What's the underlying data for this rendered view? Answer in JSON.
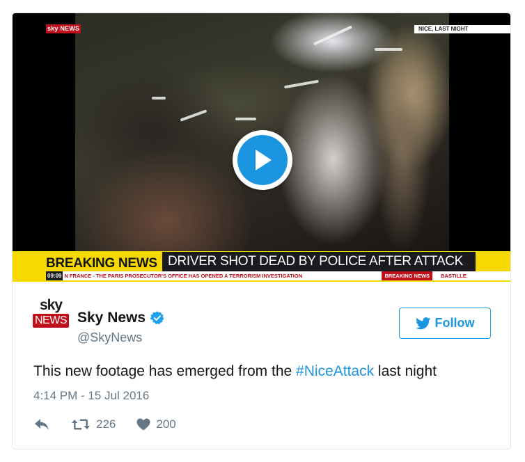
{
  "video": {
    "channel_logo": "sky NEWS",
    "location_bug": "NICE, LAST NIGHT",
    "breaking_label": "BREAKING NEWS",
    "headline": "DRIVER SHOT DEAD BY POLICE AFTER ATTACK",
    "ticker_time": "09:09",
    "ticker_text": "N FRANCE - THE PARIS PROSECUTOR'S OFFICE HAS OPENED A TERRORISM INVESTIGATION",
    "ticker_tag": "BREAKING NEWS",
    "ticker_next": "BASTILLE",
    "play_icon": "play-icon"
  },
  "author": {
    "avatar_top": "sky",
    "avatar_bottom": "NEWS",
    "display_name": "Sky News",
    "handle": "@SkyNews",
    "verified_icon": "verified-badge-icon"
  },
  "follow_button": {
    "label": "Follow",
    "icon": "twitter-bird-icon"
  },
  "tweet": {
    "text_before": "This new footage has emerged from the ",
    "hashtag": "#NiceAttack",
    "text_after": " last night",
    "timestamp": "4:14 PM - 15 Jul 2016"
  },
  "actions": {
    "reply_icon": "reply-icon",
    "retweet_icon": "retweet-icon",
    "retweet_count": "226",
    "like_icon": "heart-icon",
    "like_count": "200"
  },
  "colors": {
    "accent": "#1b95e0",
    "muted": "#657786",
    "sky_red": "#c20f1c",
    "breaking_yellow": "#f5d900"
  }
}
